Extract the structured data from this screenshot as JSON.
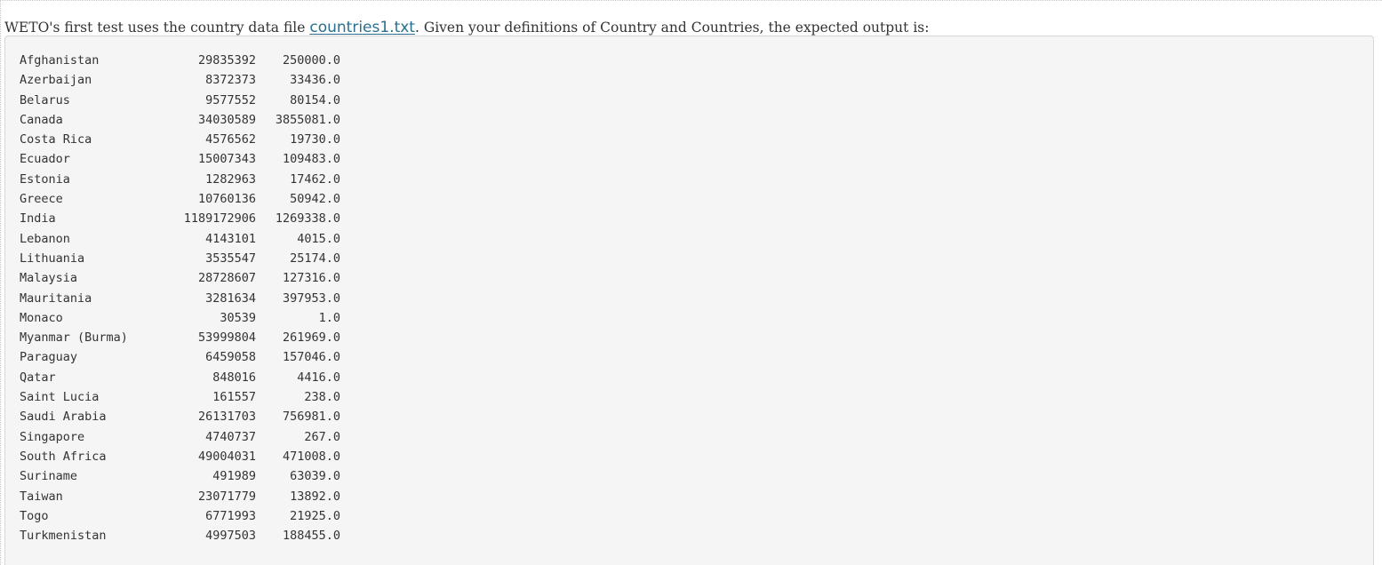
{
  "intro": {
    "before_link": "WETO's first test uses the country data file ",
    "link_text": "countries1.txt",
    "after_link": ". Given your definitions of Country and Countries, the expected output is:"
  },
  "output_rows": [
    {
      "name": "Afghanistan",
      "population": "29835392",
      "area": "250000.0"
    },
    {
      "name": "Azerbaijan",
      "population": "8372373",
      "area": "33436.0"
    },
    {
      "name": "Belarus",
      "population": "9577552",
      "area": "80154.0"
    },
    {
      "name": "Canada",
      "population": "34030589",
      "area": "3855081.0"
    },
    {
      "name": "Costa Rica",
      "population": "4576562",
      "area": "19730.0"
    },
    {
      "name": "Ecuador",
      "population": "15007343",
      "area": "109483.0"
    },
    {
      "name": "Estonia",
      "population": "1282963",
      "area": "17462.0"
    },
    {
      "name": "Greece",
      "population": "10760136",
      "area": "50942.0"
    },
    {
      "name": "India",
      "population": "1189172906",
      "area": "1269338.0"
    },
    {
      "name": "Lebanon",
      "population": "4143101",
      "area": "4015.0"
    },
    {
      "name": "Lithuania",
      "population": "3535547",
      "area": "25174.0"
    },
    {
      "name": "Malaysia",
      "population": "28728607",
      "area": "127316.0"
    },
    {
      "name": "Mauritania",
      "population": "3281634",
      "area": "397953.0"
    },
    {
      "name": "Monaco",
      "population": "30539",
      "area": "1.0"
    },
    {
      "name": "Myanmar (Burma)",
      "population": "53999804",
      "area": "261969.0"
    },
    {
      "name": "Paraguay",
      "population": "6459058",
      "area": "157046.0"
    },
    {
      "name": "Qatar",
      "population": "848016",
      "area": "4416.0"
    },
    {
      "name": "Saint Lucia",
      "population": "161557",
      "area": "238.0"
    },
    {
      "name": "Saudi Arabia",
      "population": "26131703",
      "area": "756981.0"
    },
    {
      "name": "Singapore",
      "population": "4740737",
      "area": "267.0"
    },
    {
      "name": "South Africa",
      "population": "49004031",
      "area": "471008.0"
    },
    {
      "name": "Suriname",
      "population": "491989",
      "area": "63039.0"
    },
    {
      "name": "Taiwan",
      "population": "23071779",
      "area": "13892.0"
    },
    {
      "name": "Togo",
      "population": "6771993",
      "area": "21925.0"
    },
    {
      "name": "Turkmenistan",
      "population": "4997503",
      "area": "188455.0"
    }
  ]
}
